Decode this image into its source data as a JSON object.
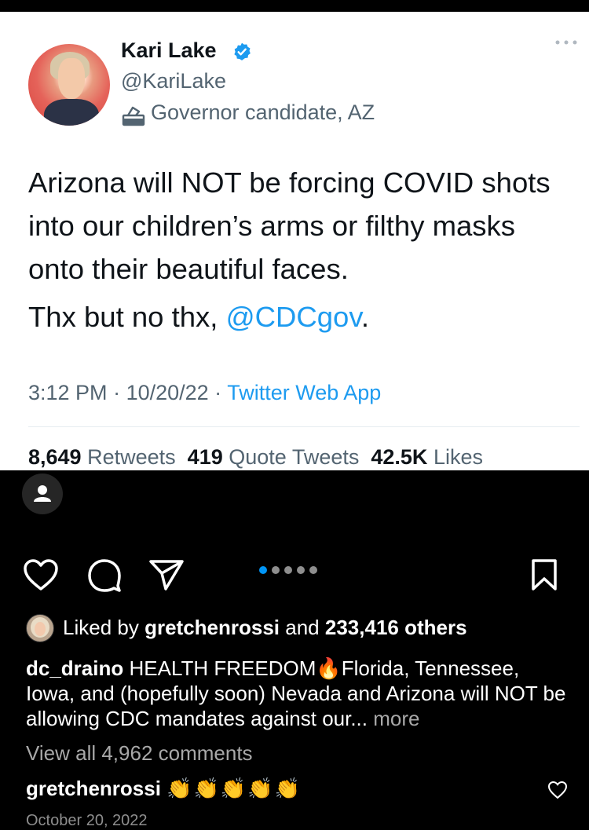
{
  "tweet": {
    "author_name": "Kari Lake",
    "author_handle": "@KariLake",
    "author_label": "Governor candidate, AZ",
    "text_main": "Arizona will NOT be forcing COVID shots into our children’s arms or filthy masks onto their beautiful faces.",
    "text_prefix": "Thx but no thx, ",
    "text_mention": "@CDCgov",
    "text_suffix": ".",
    "time": "3:12 PM",
    "date": "10/20/22",
    "source_app": "Twitter Web App",
    "retweets_count": "8,649",
    "retweets_label": "Retweets",
    "quotes_count": "419",
    "quotes_label": "Quote Tweets",
    "likes_count": "42.5K",
    "likes_label": "Likes"
  },
  "post": {
    "carousel": {
      "total": 5,
      "active": 1
    },
    "liked_prefix": "Liked by",
    "liked_user": "gretchenrossi",
    "liked_mid": "and",
    "liked_others": "233,416 others",
    "caption_user": "dc_draino",
    "caption_text_1": "HEALTH FREEDOM",
    "caption_emoji": "🔥",
    "caption_text_2": "Florida, Tennessee, Iowa, and (hopefully soon) Nevada and Arizona will NOT be allowing CDC mandates against our...",
    "caption_more": "more",
    "view_all_comments": "View all 4,962 comments",
    "comment_user": "gretchenrossi",
    "comment_text": "👏👏👏👏👏",
    "date_partial": "October 20, 2022"
  },
  "colors": {
    "link_blue": "#1d9bf0",
    "ig_blue": "#0095f6",
    "tweet_gray": "#536471"
  }
}
